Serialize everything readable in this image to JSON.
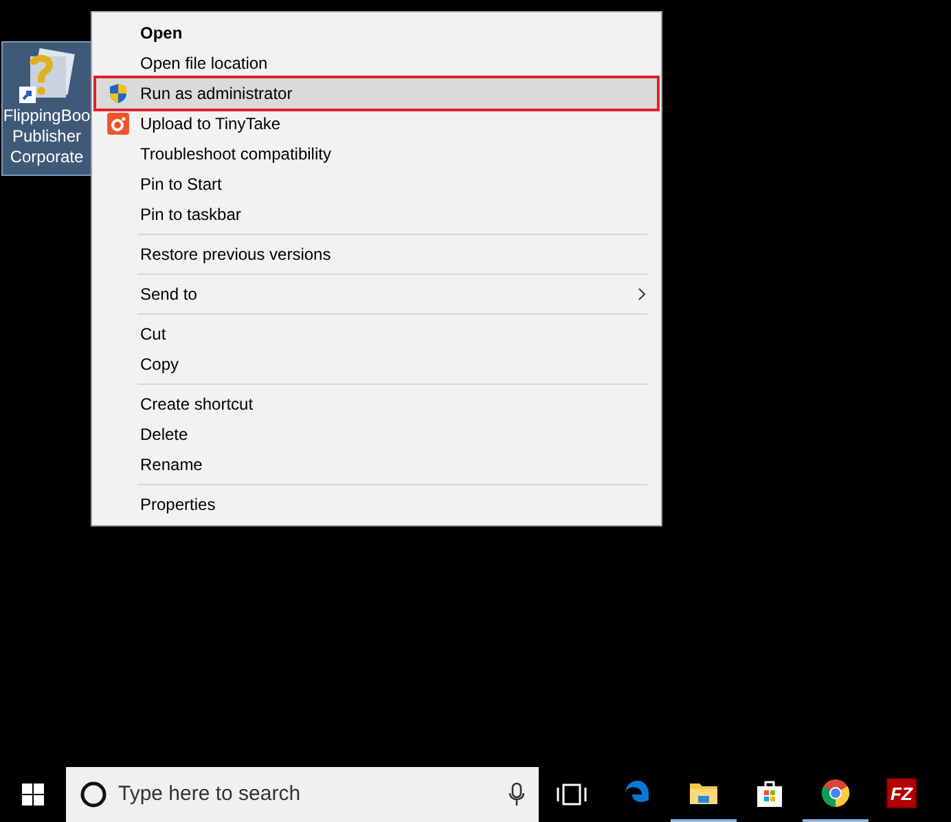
{
  "desktop_icon": {
    "label_lines": [
      "FlippingBoo",
      "Publisher",
      "Corporate"
    ],
    "selected": true
  },
  "context_menu": {
    "items": [
      {
        "kind": "plain",
        "label": "Open",
        "bold": true,
        "selected": false
      },
      {
        "kind": "plain",
        "label": "Open file location",
        "bold": false,
        "selected": false
      },
      {
        "kind": "shield",
        "label": "Run as administrator",
        "bold": false,
        "selected": true
      },
      {
        "kind": "app",
        "label": "Upload to TinyTake",
        "bold": false,
        "selected": false
      },
      {
        "kind": "plain",
        "label": "Troubleshoot compatibility",
        "bold": false,
        "selected": false
      },
      {
        "kind": "plain",
        "label": "Pin to Start",
        "bold": false,
        "selected": false
      },
      {
        "kind": "plain",
        "label": "Pin to taskbar",
        "bold": false,
        "selected": false
      },
      {
        "kind": "separator"
      },
      {
        "kind": "plain",
        "label": "Restore previous versions",
        "bold": false,
        "selected": false
      },
      {
        "kind": "separator"
      },
      {
        "kind": "submenu",
        "label": "Send to",
        "bold": false,
        "selected": false
      },
      {
        "kind": "separator"
      },
      {
        "kind": "plain",
        "label": "Cut",
        "bold": false,
        "selected": false
      },
      {
        "kind": "plain",
        "label": "Copy",
        "bold": false,
        "selected": false
      },
      {
        "kind": "separator"
      },
      {
        "kind": "plain",
        "label": "Create shortcut",
        "bold": false,
        "selected": false
      },
      {
        "kind": "plain",
        "label": "Delete",
        "bold": false,
        "selected": false
      },
      {
        "kind": "plain",
        "label": "Rename",
        "bold": false,
        "selected": false
      },
      {
        "kind": "separator"
      },
      {
        "kind": "plain",
        "label": "Properties",
        "bold": false,
        "selected": false
      }
    ]
  },
  "taskbar": {
    "search": {
      "placeholder": "Type here to search"
    },
    "apps": [
      {
        "kind": "edge",
        "running": false
      },
      {
        "kind": "explorer",
        "running": true
      },
      {
        "kind": "store",
        "running": false
      },
      {
        "kind": "chrome",
        "running": true
      },
      {
        "kind": "filezilla",
        "running": false,
        "label": "FZ"
      }
    ]
  }
}
